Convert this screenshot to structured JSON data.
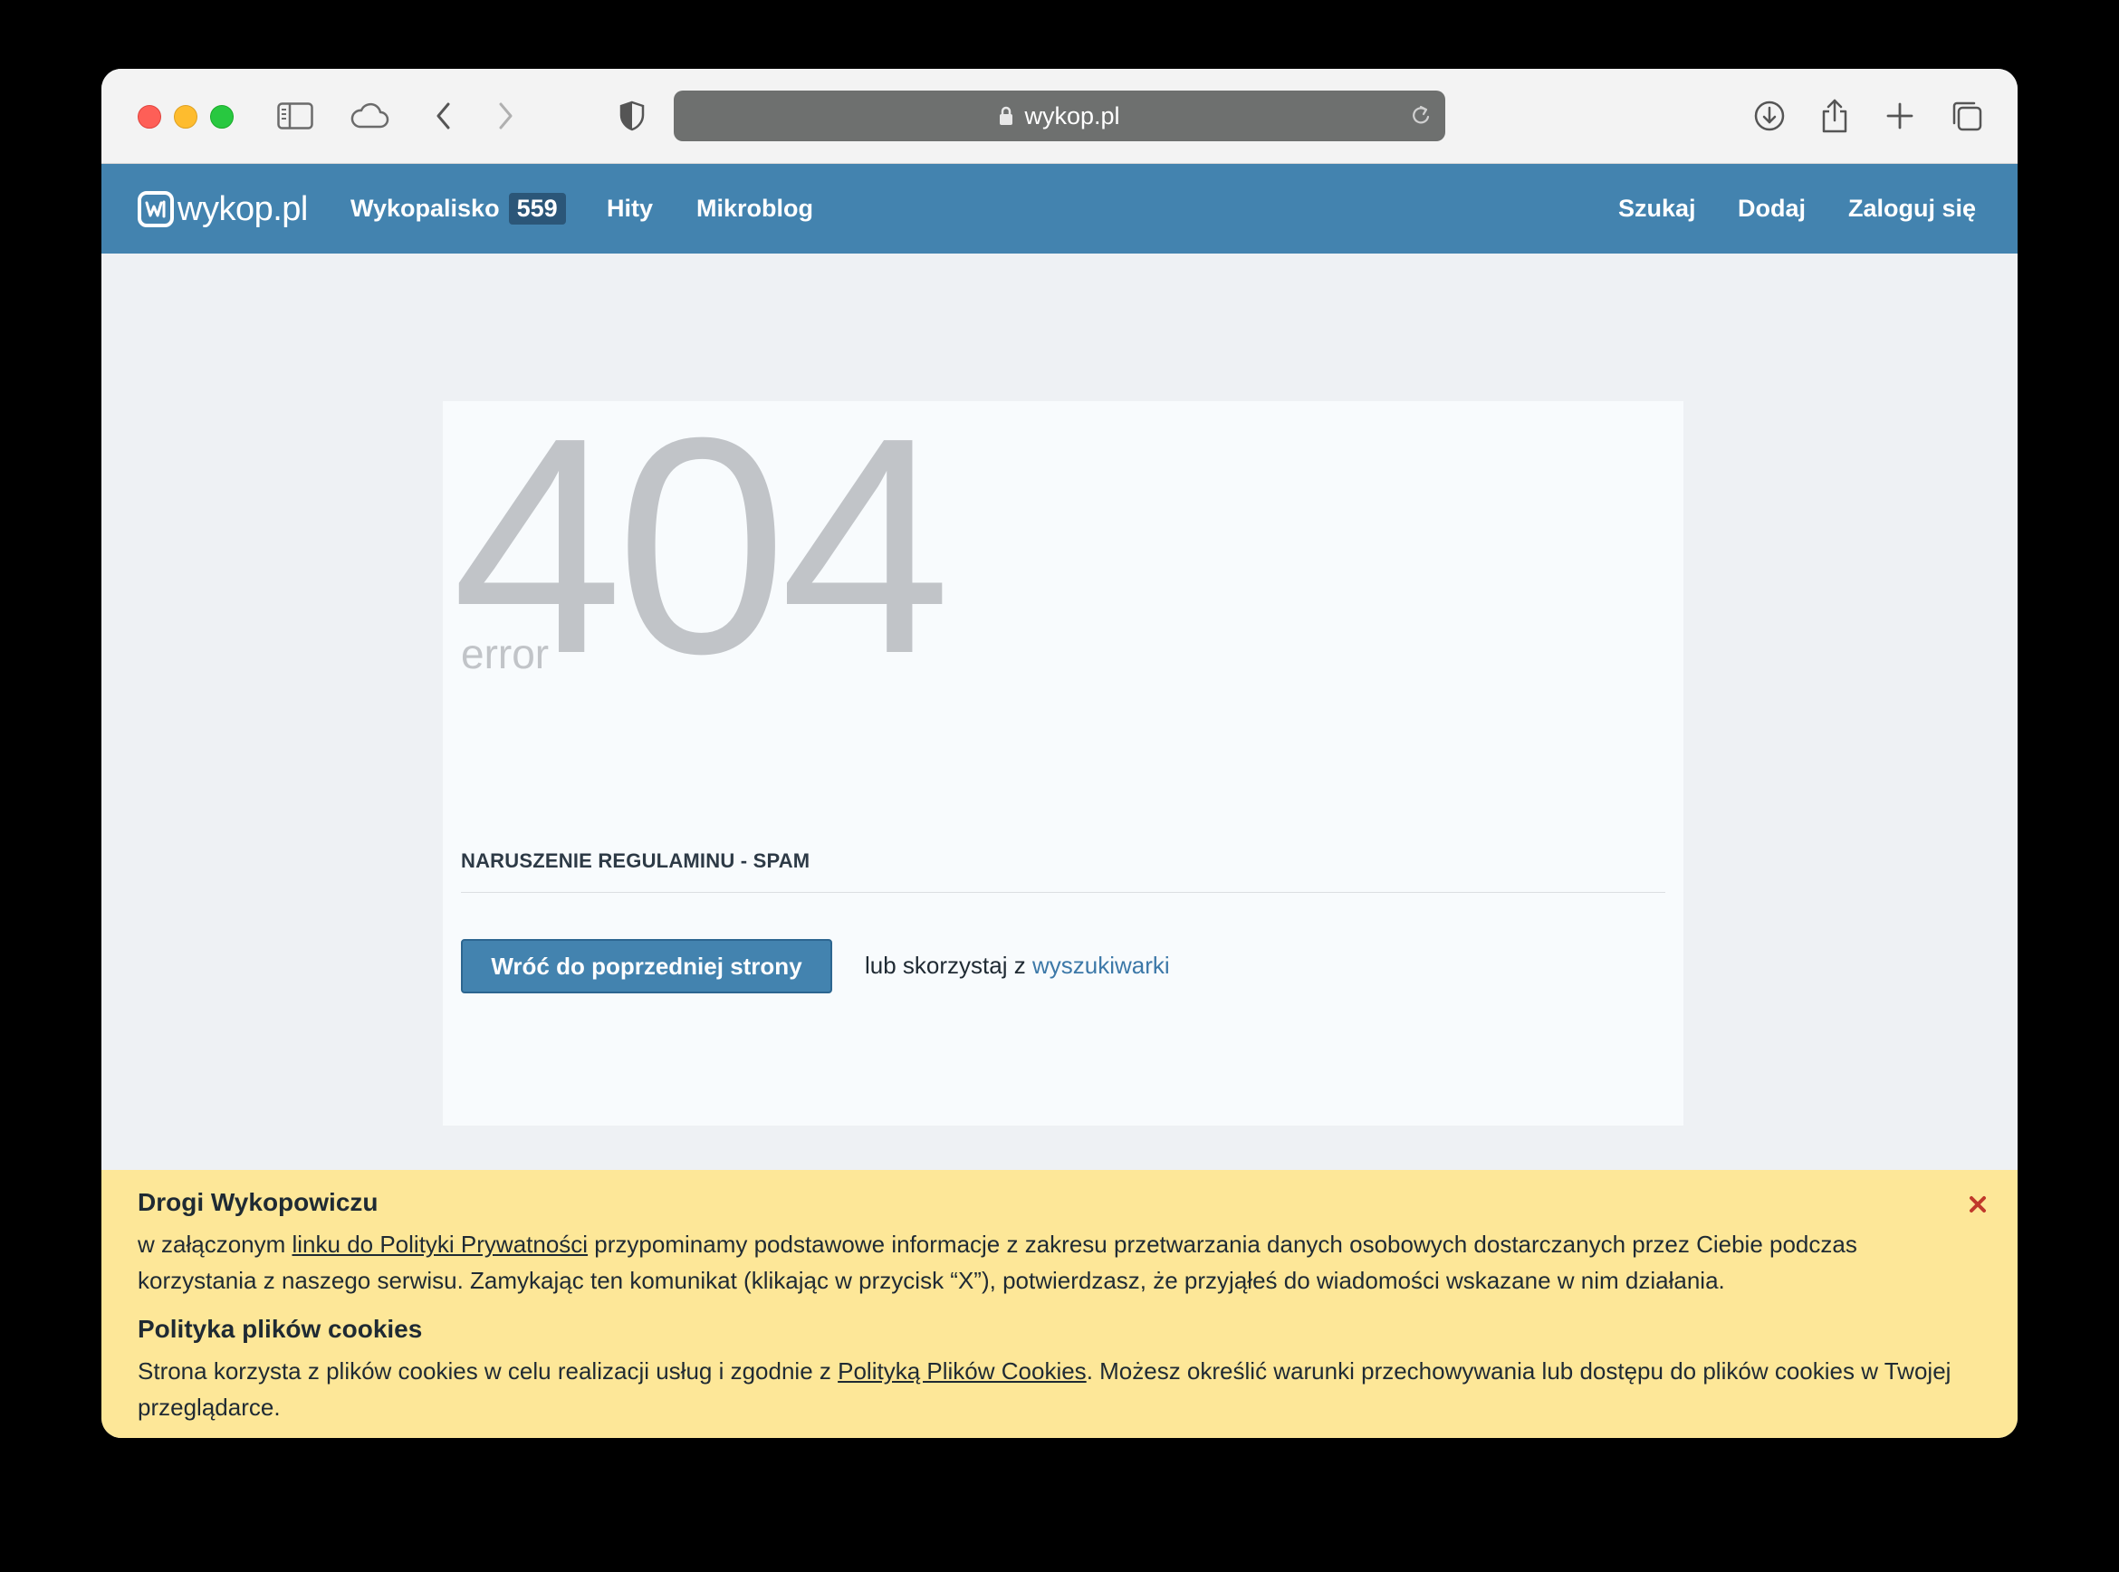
{
  "browser": {
    "url": "wykop.pl",
    "icons": [
      "sidebar-icon",
      "icloud-tabs-icon",
      "back-icon",
      "forward-icon",
      "privacy-shield-icon",
      "lock-icon",
      "reload-icon",
      "download-icon",
      "share-icon",
      "new-tab-icon",
      "tab-overview-icon"
    ]
  },
  "header": {
    "logo_text": "wykop.pl",
    "nav": [
      {
        "label": "Wykopalisko",
        "badge": "559"
      },
      {
        "label": "Hity"
      },
      {
        "label": "Mikroblog"
      }
    ],
    "nav_right": [
      {
        "label": "Szukaj"
      },
      {
        "label": "Dodaj"
      },
      {
        "label": "Zaloguj się"
      }
    ]
  },
  "error_page": {
    "code": "404",
    "error_label": "error",
    "reason": "NARUSZENIE REGULAMINU - SPAM",
    "back_button": "Wróć do poprzedniej strony",
    "or_text": "lub skorzystaj z",
    "search_link": "wyszukiwarki"
  },
  "cookie_notice": {
    "title": "Drogi Wykopowiczu",
    "privacy_text_before": "w załączonym ",
    "privacy_link": "linku do Polityki Prywatności",
    "privacy_text_after": " przypominamy podstawowe informacje z zakresu przetwarzania danych osobowych dostarczanych przez Ciebie podczas korzystania z naszego serwisu. Zamykając ten komunikat (klikając w przycisk “X”), potwierdzasz, że przyjąłeś do wiadomości wskazane w nim działania.",
    "cookies_title": "Polityka plików cookies",
    "cookies_text_before": "Strona korzysta z plików cookies w celu realizacji usług i zgodnie z ",
    "cookies_link": "Polityką Plików Cookies",
    "cookies_text_after": ". Możesz określić warunki przechowywania lub dostępu do plików cookies w Twojej przeglądarce."
  },
  "colors": {
    "header_blue": "#4383af",
    "badge_dark": "#2b5678",
    "notice_yellow": "#fde798",
    "close_red": "#c0392b",
    "error_grey": "#c1c4c8"
  }
}
